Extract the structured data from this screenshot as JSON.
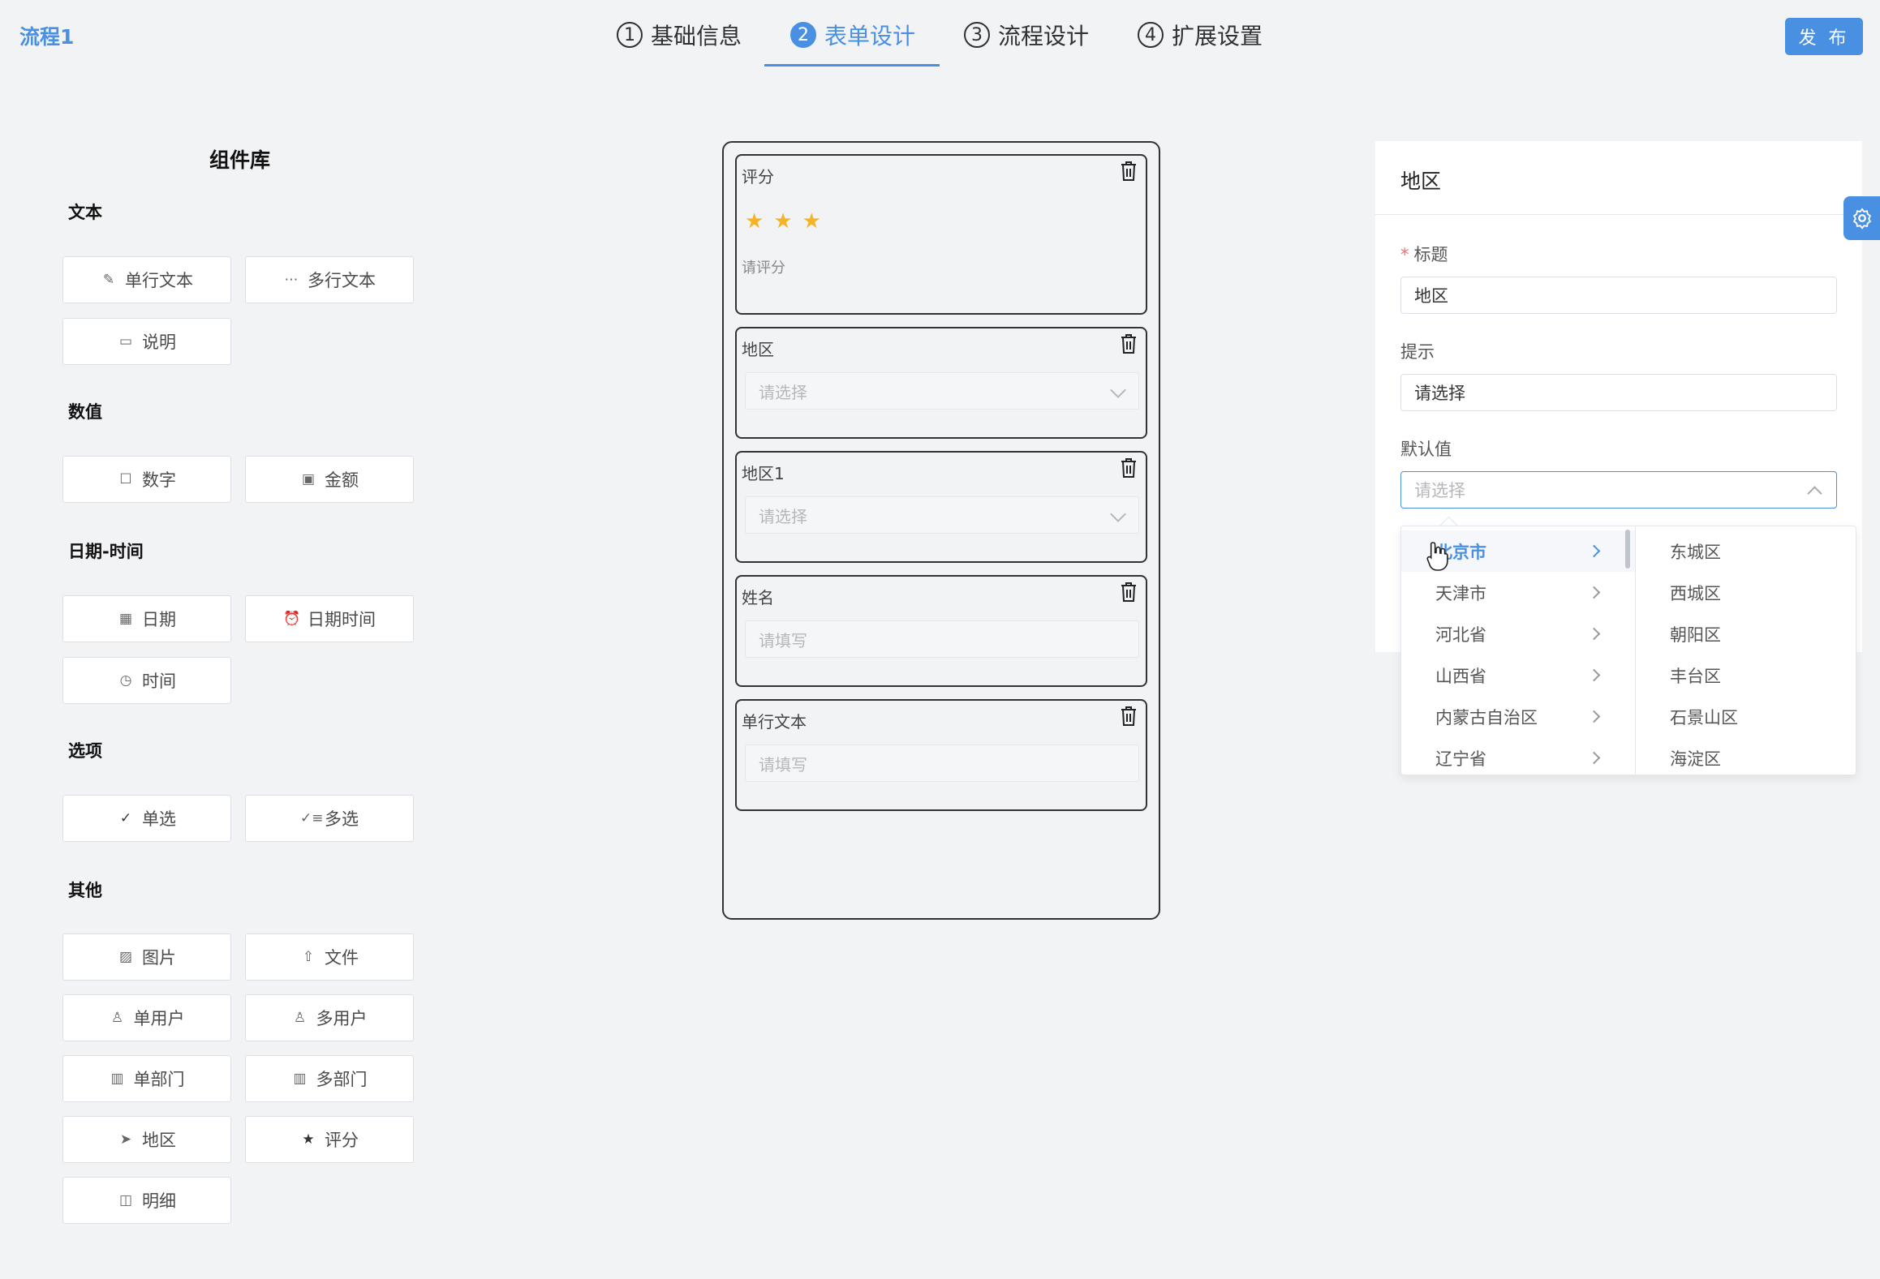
{
  "header": {
    "flow_title": "流程1",
    "steps": [
      {
        "num": "1",
        "label": "基础信息",
        "active": false
      },
      {
        "num": "2",
        "label": "表单设计",
        "active": true
      },
      {
        "num": "3",
        "label": "流程设计",
        "active": false
      },
      {
        "num": "4",
        "label": "扩展设置",
        "active": false
      }
    ],
    "publish_label": "发 布"
  },
  "palette": {
    "title": "组件库",
    "groups": [
      {
        "title": "文本",
        "items": [
          {
            "label": "单行文本",
            "icon": "pencil-icon"
          },
          {
            "label": "多行文本",
            "icon": "ellipsis-icon"
          },
          {
            "label": "说明",
            "icon": "comment-icon"
          }
        ]
      },
      {
        "title": "数值",
        "items": [
          {
            "label": "数字",
            "icon": "edit-icon"
          },
          {
            "label": "金额",
            "icon": "money-icon"
          }
        ]
      },
      {
        "title": "日期-时间",
        "items": [
          {
            "label": "日期",
            "icon": "calendar-icon"
          },
          {
            "label": "日期时间",
            "icon": "alarm-clock-icon"
          },
          {
            "label": "时间",
            "icon": "stopwatch-icon"
          }
        ]
      },
      {
        "title": "选项",
        "items": [
          {
            "label": "单选",
            "icon": "check-icon"
          },
          {
            "label": "多选",
            "icon": "multi-check-icon"
          }
        ]
      },
      {
        "title": "其他",
        "items": [
          {
            "label": "图片",
            "icon": "image-icon"
          },
          {
            "label": "文件",
            "icon": "upload-icon"
          },
          {
            "label": "单用户",
            "icon": "user-icon"
          },
          {
            "label": "多用户",
            "icon": "user-icon"
          },
          {
            "label": "单部门",
            "icon": "building-icon"
          },
          {
            "label": "多部门",
            "icon": "building-icon"
          },
          {
            "label": "地区",
            "icon": "location-arrow-icon"
          },
          {
            "label": "评分",
            "icon": "star-icon"
          },
          {
            "label": "明细",
            "icon": "briefcase-icon"
          }
        ]
      }
    ]
  },
  "form": {
    "fields": [
      {
        "label": "评分",
        "type": "rate",
        "rating": 3,
        "hint": "请评分"
      },
      {
        "label": "地区",
        "type": "select",
        "placeholder": "请选择"
      },
      {
        "label": "地区1",
        "type": "select",
        "placeholder": "请选择"
      },
      {
        "label": "姓名",
        "type": "input",
        "placeholder": "请填写"
      },
      {
        "label": "单行文本",
        "type": "input",
        "placeholder": "请填写"
      }
    ]
  },
  "props": {
    "title": "地区",
    "label_title": "标题",
    "required_mark": "*",
    "title_value": "地区",
    "label_hint": "提示",
    "hint_value": "请选择",
    "label_default": "默认值",
    "default_placeholder": "请选择"
  },
  "cascader": {
    "provinces": [
      {
        "label": "北京市",
        "active": true
      },
      {
        "label": "天津市",
        "active": false
      },
      {
        "label": "河北省",
        "active": false
      },
      {
        "label": "山西省",
        "active": false
      },
      {
        "label": "内蒙古自治区",
        "active": false
      },
      {
        "label": "辽宁省",
        "active": false
      }
    ],
    "districts": [
      "东城区",
      "西城区",
      "朝阳区",
      "丰台区",
      "石景山区",
      "海淀区"
    ]
  },
  "colors": {
    "accent": "#4a90e2",
    "star": "#f5b428",
    "background": "#f2f3f5"
  }
}
